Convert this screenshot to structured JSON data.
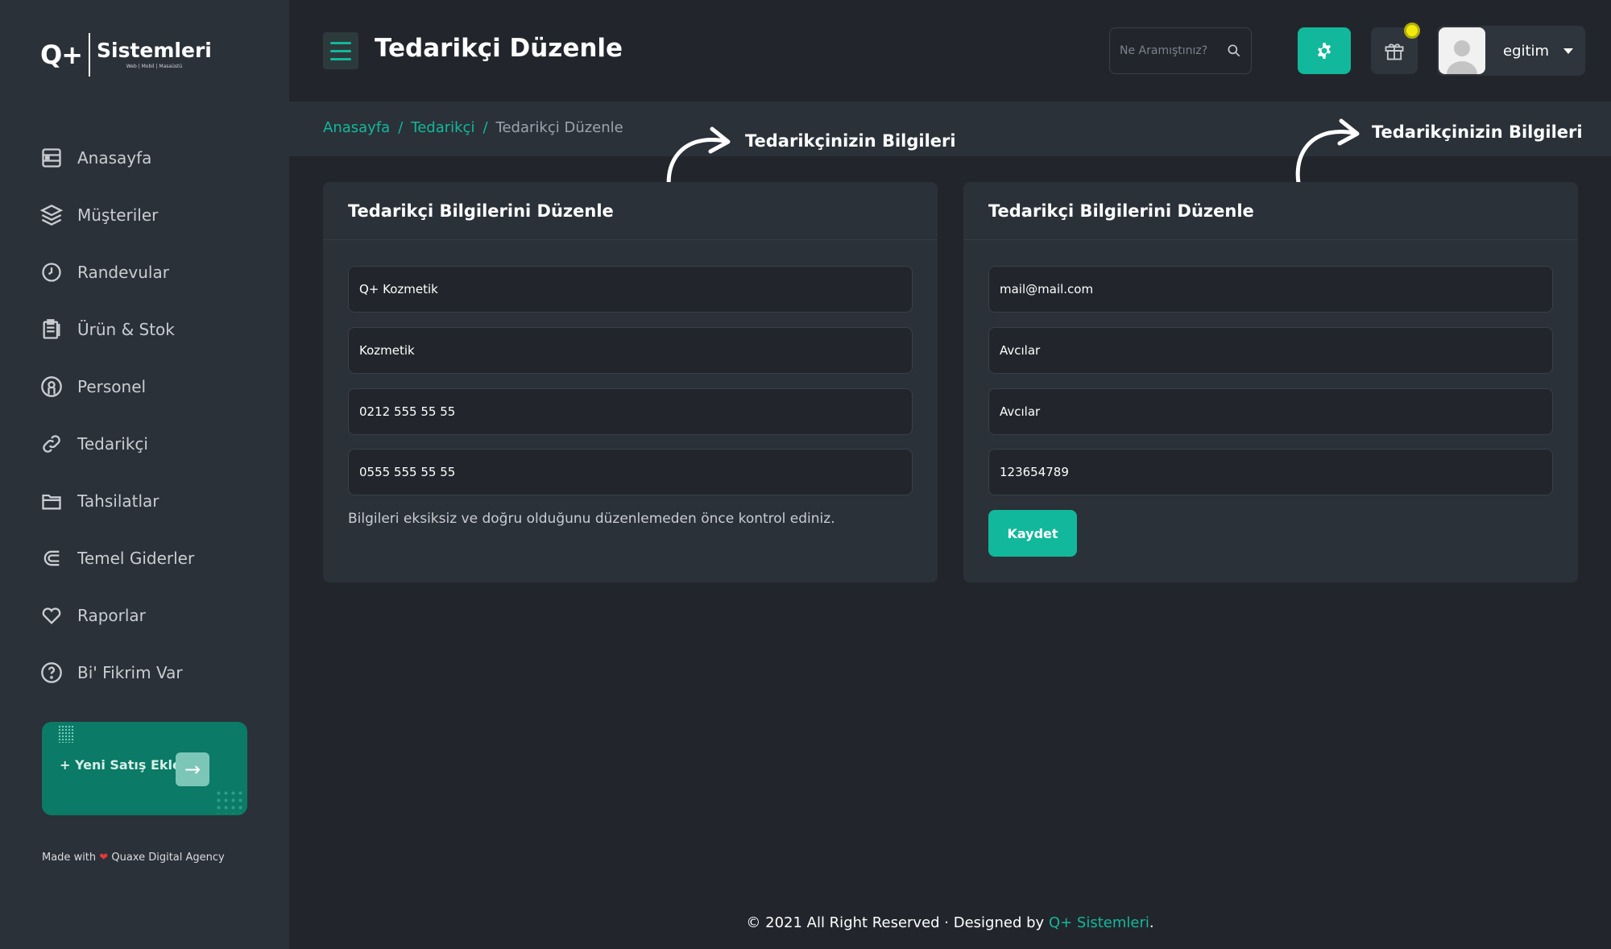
{
  "sidebar": {
    "logo": {
      "mark": "Q+",
      "text": "Sistemleri",
      "sub": "Web | Mobil | Masaüstü"
    },
    "items": [
      {
        "label": "Anasayfa",
        "icon": "dashboard-icon"
      },
      {
        "label": "Müşteriler",
        "icon": "layers-icon"
      },
      {
        "label": "Randevular",
        "icon": "clock-icon"
      },
      {
        "label": "Ürün & Stok",
        "icon": "clipboard-icon"
      },
      {
        "label": "Personel",
        "icon": "user-circle-icon"
      },
      {
        "label": "Tedarikçi",
        "icon": "link-icon"
      },
      {
        "label": "Tahsilatlar",
        "icon": "folder-icon"
      },
      {
        "label": "Temel Giderler",
        "icon": "magnet-icon"
      },
      {
        "label": "Raporlar",
        "icon": "heart-icon"
      },
      {
        "label": "Bi' Fikrim Var",
        "icon": "help-circle-icon"
      }
    ],
    "sale_card": {
      "label": "+ Yeni Satış Ekle",
      "arrow": "→"
    },
    "made_with": {
      "prefix": "Made with",
      "heart": "❤",
      "agency": "Quaxe Digital Agency"
    }
  },
  "header": {
    "title": "Tedarikçi Düzenle",
    "search_placeholder": "Ne Aramıştınız?",
    "user_name": "egitim"
  },
  "breadcrumb": {
    "home": "Anasayfa",
    "sep": "/",
    "section": "Tedarikçi",
    "current": "Tedarikçi Düzenle"
  },
  "annotations": {
    "left": "Tedarikçinizin Bilgileri",
    "right": "Tedarikçinizin Bilgileri"
  },
  "left_card": {
    "title": "Tedarikçi Bilgilerini Düzenle",
    "fields": [
      "Q+ Kozmetik",
      "Kozmetik",
      "0212 555 55 55",
      "0555 555 55 55"
    ],
    "note": "Bilgileri eksiksiz ve doğru olduğunu düzenlemeden önce kontrol ediniz."
  },
  "right_card": {
    "title": "Tedarikçi Bilgilerini Düzenle",
    "fields": [
      "mail@mail.com",
      "Avcılar",
      "Avcılar",
      "123654789"
    ],
    "save_label": "Kaydet"
  },
  "footer": {
    "text": "© 2021 All Right Reserved · Designed by",
    "brand": "Q+ Sistemleri",
    "end": "."
  },
  "colors": {
    "accent": "#12b89b",
    "sidebar_bg": "#2b3139",
    "page_bg": "#22262c",
    "sale_card_bg": "#0b7a66",
    "notification": "#f2ea0c"
  }
}
